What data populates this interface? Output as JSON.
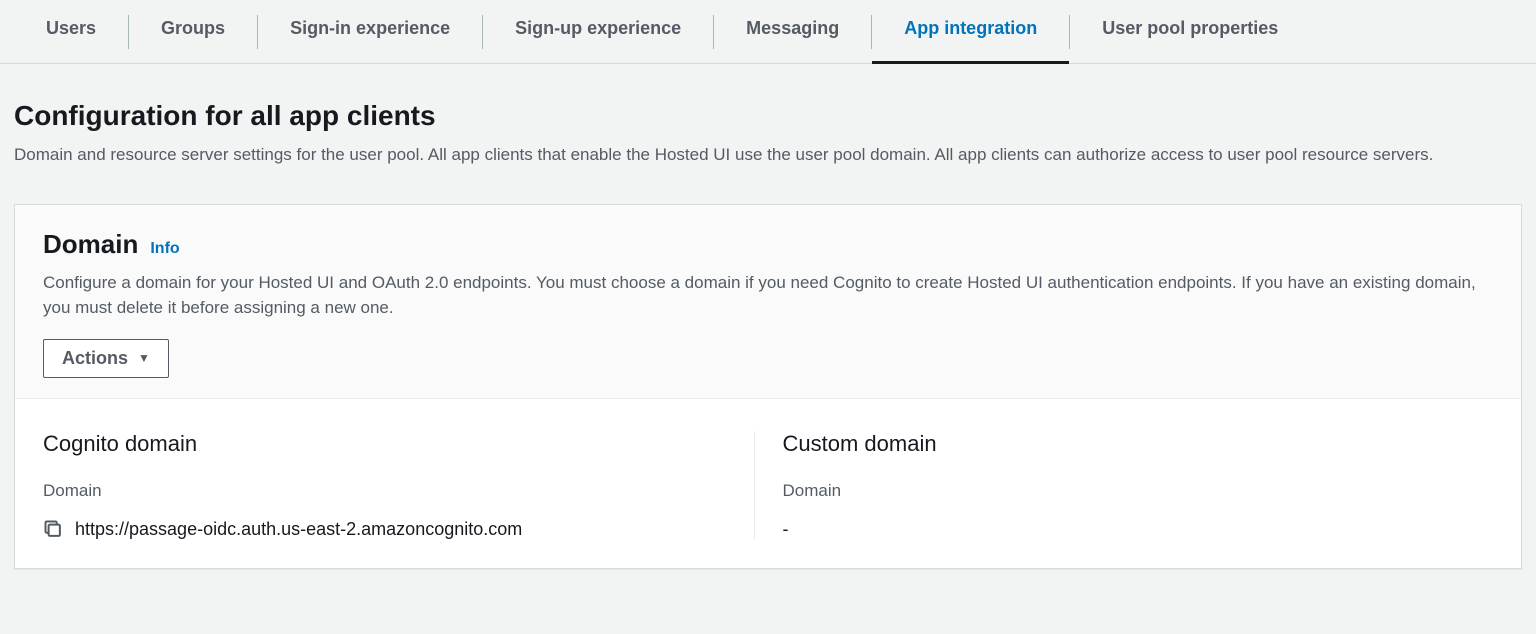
{
  "tabs": [
    {
      "label": "Users",
      "active": false
    },
    {
      "label": "Groups",
      "active": false
    },
    {
      "label": "Sign-in experience",
      "active": false
    },
    {
      "label": "Sign-up experience",
      "active": false
    },
    {
      "label": "Messaging",
      "active": false
    },
    {
      "label": "App integration",
      "active": true
    },
    {
      "label": "User pool properties",
      "active": false
    }
  ],
  "section": {
    "title": "Configuration for all app clients",
    "desc": "Domain and resource server settings for the user pool. All app clients that enable the Hosted UI use the user pool domain. All app clients can authorize access to user pool resource servers."
  },
  "domain_card": {
    "title": "Domain",
    "info_label": "Info",
    "desc": "Configure a domain for your Hosted UI and OAuth 2.0 endpoints. You must choose a domain if you need Cognito to create Hosted UI authentication endpoints. If you have an existing domain, you must delete it before assigning a new one.",
    "actions_label": "Actions",
    "cognito": {
      "heading": "Cognito domain",
      "label": "Domain",
      "value": "https://passage-oidc.auth.us-east-2.amazoncognito.com"
    },
    "custom": {
      "heading": "Custom domain",
      "label": "Domain",
      "value": "-"
    }
  }
}
